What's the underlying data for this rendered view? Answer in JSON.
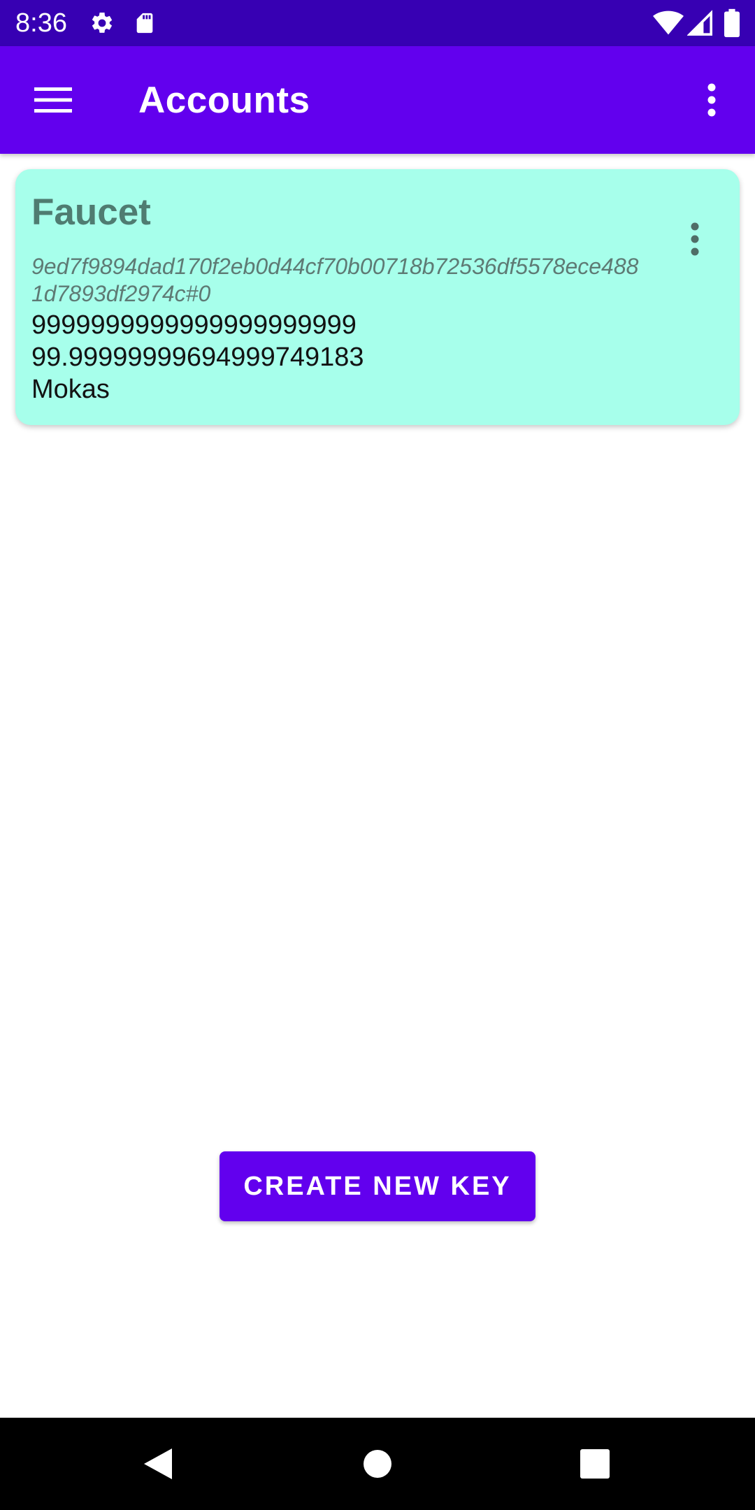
{
  "status_bar": {
    "time": "8:36",
    "left_icons": [
      "gear-icon",
      "sd-card-icon"
    ],
    "right_icons": [
      "wifi-icon",
      "signal-icon",
      "battery-icon"
    ]
  },
  "app_bar": {
    "title": "Accounts",
    "menu_icon": "hamburger-menu-icon",
    "overflow_icon": "more-vert-icon"
  },
  "accounts": [
    {
      "name": "Faucet",
      "key": "9ed7f9894dad170f2eb0d44cf70b00718b72536df5578ece4881d7893df2974c#0",
      "line1": "9999999999999999999999",
      "line2": "99.99999999694999749183",
      "line3": "Mokas"
    }
  ],
  "actions": {
    "create_label": "CREATE NEW KEY"
  },
  "colors": {
    "status_bar": "#3700b3",
    "primary": "#6200ee",
    "card_background": "#a7ffeb",
    "card_title": "#4f7c71",
    "nav_bar": "#000000"
  },
  "nav_bar": {
    "icons": [
      "back-icon",
      "home-icon",
      "recents-icon"
    ]
  }
}
